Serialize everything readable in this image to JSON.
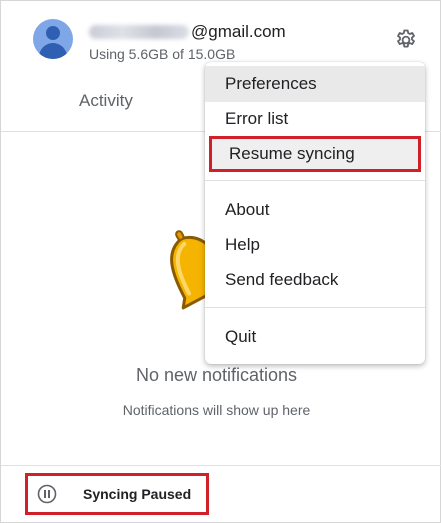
{
  "account": {
    "email_domain": "@gmail.com",
    "usage": "Using 5.6GB of 15.0GB"
  },
  "tabs": {
    "activity": "Activity"
  },
  "notifications": {
    "empty_title": "No new notifications",
    "empty_subtitle": "Notifications will show up here"
  },
  "status": {
    "label": "Syncing Paused"
  },
  "menu": {
    "items": [
      {
        "label": "Preferences"
      },
      {
        "label": "Error list"
      },
      {
        "label": "Resume syncing"
      },
      {
        "label": "About"
      },
      {
        "label": "Help"
      },
      {
        "label": "Send feedback"
      },
      {
        "label": "Quit"
      }
    ]
  },
  "icons": {
    "avatar": "account-avatar-icon",
    "settings": "gear-icon",
    "illustration": "bell-icon",
    "status": "pause-circle-icon"
  },
  "colors": {
    "highlight_border": "#d0202a",
    "avatar": "#7fa6e6",
    "bell": "#f4b400"
  }
}
